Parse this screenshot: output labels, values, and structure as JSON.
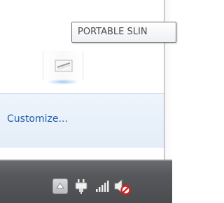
{
  "tooltip": {
    "text": "PORTABLE SLIN"
  },
  "hidden_icons": [
    {
      "name": "portable-slin-icon"
    }
  ],
  "footer": {
    "customize_label": "Customize..."
  },
  "tray": {
    "show_hidden_button": "up-arrow-icon",
    "icons": [
      "power-plug-icon",
      "signal-bars-icon",
      "speaker-muted-icon"
    ]
  },
  "colors": {
    "link": "#1e5fa8",
    "taskbar": "#56585b",
    "mute_red": "#d8211b",
    "footer_band": "#e6eef8"
  }
}
